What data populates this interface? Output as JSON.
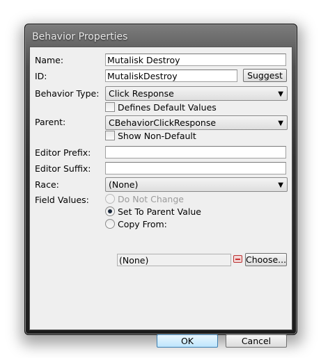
{
  "dialog": {
    "title": "Behavior Properties",
    "labels": {
      "name": "Name:",
      "id": "ID:",
      "behavior_type": "Behavior Type:",
      "parent": "Parent:",
      "editor_prefix": "Editor Prefix:",
      "editor_suffix": "Editor Suffix:",
      "race": "Race:",
      "field_values": "Field Values:"
    },
    "name_value": "Mutalisk Destroy",
    "id_value": "MutaliskDestroy",
    "suggest_label": "Suggest",
    "behavior_type_value": "Click Response",
    "defines_default_label": "Defines Default Values",
    "defines_default_checked": false,
    "parent_value": "CBehaviorClickResponse",
    "show_non_default_label": "Show Non-Default",
    "show_non_default_checked": false,
    "editor_prefix_value": "",
    "editor_suffix_value": "",
    "race_value": "(None)",
    "field_values": {
      "options": [
        "Do Not Change",
        "Set To Parent Value",
        "Copy From:"
      ],
      "selected": "Set To Parent Value",
      "disabled": [
        "Do Not Change"
      ],
      "copy_from_value": "(None)",
      "choose_label": "Choose..."
    },
    "ok_label": "OK",
    "cancel_label": "Cancel"
  },
  "colors": {
    "frame": "#2e2e2e",
    "client": "#efefef",
    "ok_border": "#3c7fb1"
  }
}
